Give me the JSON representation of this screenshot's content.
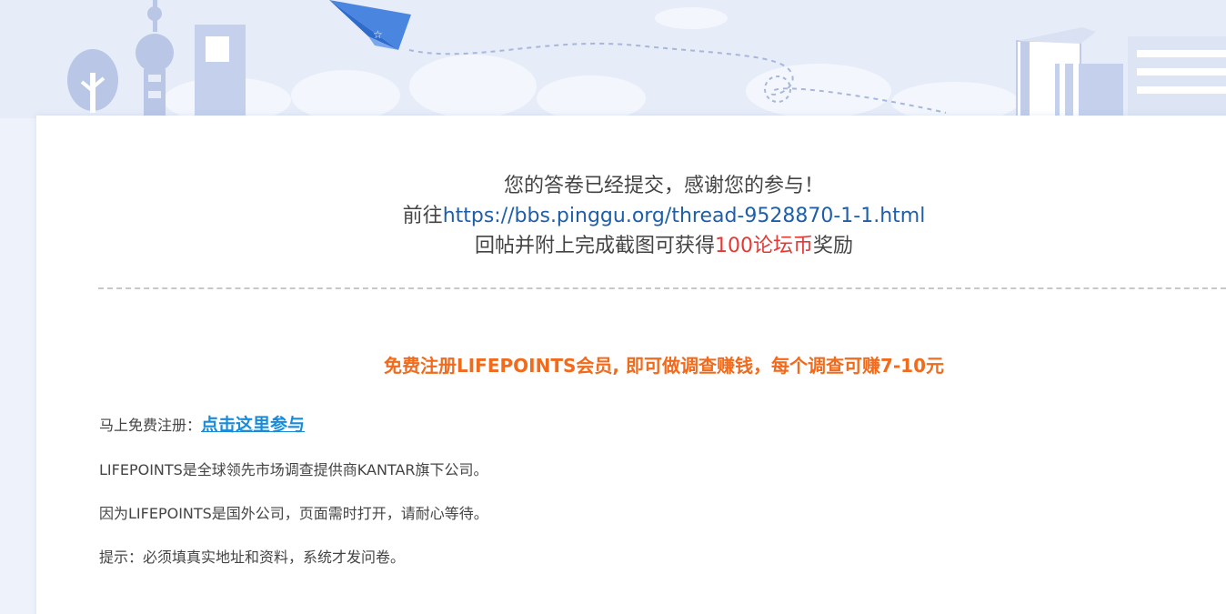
{
  "thanks": {
    "line1": "您的答卷已经提交，感谢您的参与！",
    "line2_prefix": "前往",
    "line2_link": "https://bbs.pinggu.org/thread-9528870-1-1.html",
    "line3_prefix": "回帖并附上完成截图可获得",
    "line3_reward": "100论坛币",
    "line3_suffix": "奖励"
  },
  "promo": {
    "headline": "免费注册LIFEPOINTS会员, 即可做调查赚钱，每个调查可赚7-10元"
  },
  "info": {
    "register_label": "马上免费注册：",
    "register_link": "点击这里参与",
    "about": "LIFEPOINTS是全球领先市场调查提供商KANTAR旗下公司。",
    "wait_note": "因为LIFEPOINTS是国外公司，页面需时打开，请耐心等待。",
    "tip": "提示：必须填真实地址和资料，系统才发问卷。"
  },
  "colors": {
    "banner_bg": "#e3e9f7",
    "link_blue": "#1f5fa8",
    "reward_red": "#e53935",
    "promo_orange": "#f26a1b",
    "join_link_blue": "#1a8bd8"
  }
}
